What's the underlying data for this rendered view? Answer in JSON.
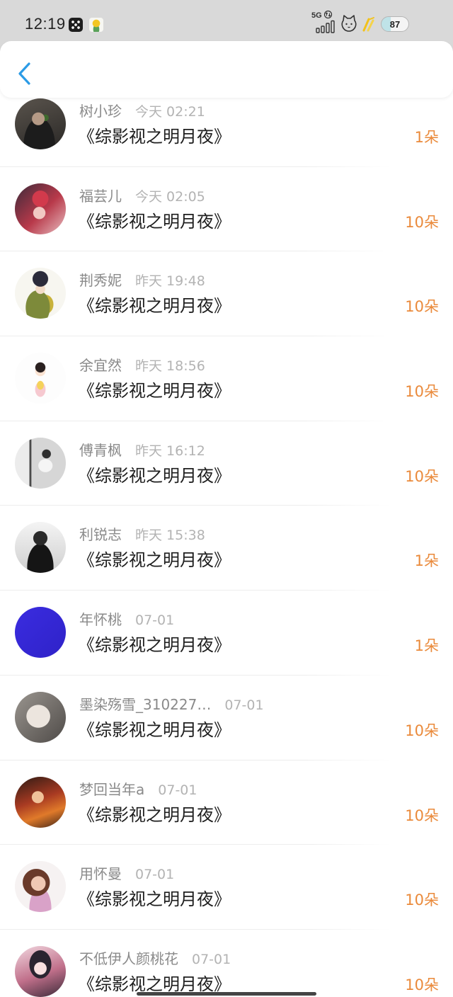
{
  "status_bar": {
    "time": "12:19",
    "network_label": "5G",
    "battery_level": "87",
    "icons": [
      "app-notification-icon",
      "app-notification-icon",
      "data-activity-icon",
      "signal-icon",
      "pet-icon",
      "feather-icon",
      "battery-icon"
    ]
  },
  "header": {
    "back_icon": "chevron-left-icon"
  },
  "colors": {
    "accent": "#2b9be6",
    "amount": "#ea8a3b",
    "status_bar_bg": "#d9d9d9"
  },
  "records": [
    {
      "name": "树小珍",
      "time": "今天 02:21",
      "title": "《综影视之明月夜》",
      "amount": "1朵"
    },
    {
      "name": "福芸儿",
      "time": "今天 02:05",
      "title": "《综影视之明月夜》",
      "amount": "10朵"
    },
    {
      "name": "荆秀妮",
      "time": "昨天 19:48",
      "title": "《综影视之明月夜》",
      "amount": "10朵"
    },
    {
      "name": "余宜然",
      "time": "昨天 18:56",
      "title": "《综影视之明月夜》",
      "amount": "10朵"
    },
    {
      "name": "傅青枫",
      "time": "昨天 16:12",
      "title": "《综影视之明月夜》",
      "amount": "10朵"
    },
    {
      "name": "利锐志",
      "time": "昨天 15:38",
      "title": "《综影视之明月夜》",
      "amount": "1朵"
    },
    {
      "name": "年怀桃",
      "time": "07-01",
      "title": "《综影视之明月夜》",
      "amount": "1朵"
    },
    {
      "name": "墨染殇雪_310227…",
      "time": "07-01",
      "title": "《综影视之明月夜》",
      "amount": "10朵"
    },
    {
      "name": "梦回当年a",
      "time": "07-01",
      "title": "《综影视之明月夜》",
      "amount": "10朵"
    },
    {
      "name": "用怀曼",
      "time": "07-01",
      "title": "《综影视之明月夜》",
      "amount": "10朵"
    },
    {
      "name": "不低伊人颜桃花",
      "time": "07-01",
      "title": "《综影视之明月夜》",
      "amount": "10朵"
    }
  ]
}
